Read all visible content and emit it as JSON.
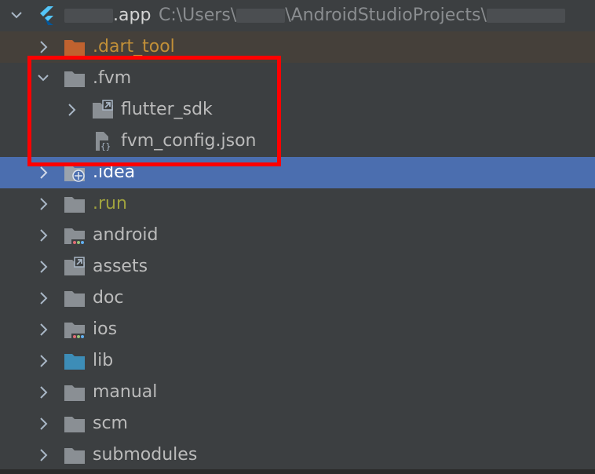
{
  "project": {
    "name_suffix": ".app",
    "path_prefix": "C:\\Users\\",
    "path_middle": "\\AndroidStudioProjects\\"
  },
  "tree": [
    {
      "label": ".dart_tool",
      "state": "collapsed",
      "icon": "folder-orange-icon",
      "style": "excluded"
    },
    {
      "label": ".fvm",
      "state": "expanded",
      "icon": "folder-icon"
    },
    {
      "label": "flutter_sdk",
      "state": "collapsed",
      "icon": "symlink-folder-icon"
    },
    {
      "label": "fvm_config.json",
      "state": "leaf",
      "icon": "json-file-icon"
    },
    {
      "label": ".idea",
      "state": "collapsed",
      "icon": "idea-folder-icon",
      "style": "selected"
    },
    {
      "label": ".run",
      "state": "collapsed",
      "icon": "folder-icon"
    },
    {
      "label": "android",
      "state": "collapsed",
      "icon": "module-folder-icon"
    },
    {
      "label": "assets",
      "state": "collapsed",
      "icon": "symlink-folder-icon"
    },
    {
      "label": "doc",
      "state": "collapsed",
      "icon": "folder-icon"
    },
    {
      "label": "ios",
      "state": "collapsed",
      "icon": "module-folder-icon"
    },
    {
      "label": "lib",
      "state": "collapsed",
      "icon": "source-folder-icon"
    },
    {
      "label": "manual",
      "state": "collapsed",
      "icon": "folder-icon"
    },
    {
      "label": "scm",
      "state": "collapsed",
      "icon": "folder-icon"
    },
    {
      "label": "submodules",
      "state": "collapsed",
      "icon": "folder-icon"
    }
  ],
  "colors": {
    "background": "#3c3f41",
    "selection": "#4b6eaf",
    "excluded_bg": "#45403a",
    "highlight": "#ff0000",
    "folder": "#8a8f94",
    "source_folder": "#3d8db7"
  }
}
